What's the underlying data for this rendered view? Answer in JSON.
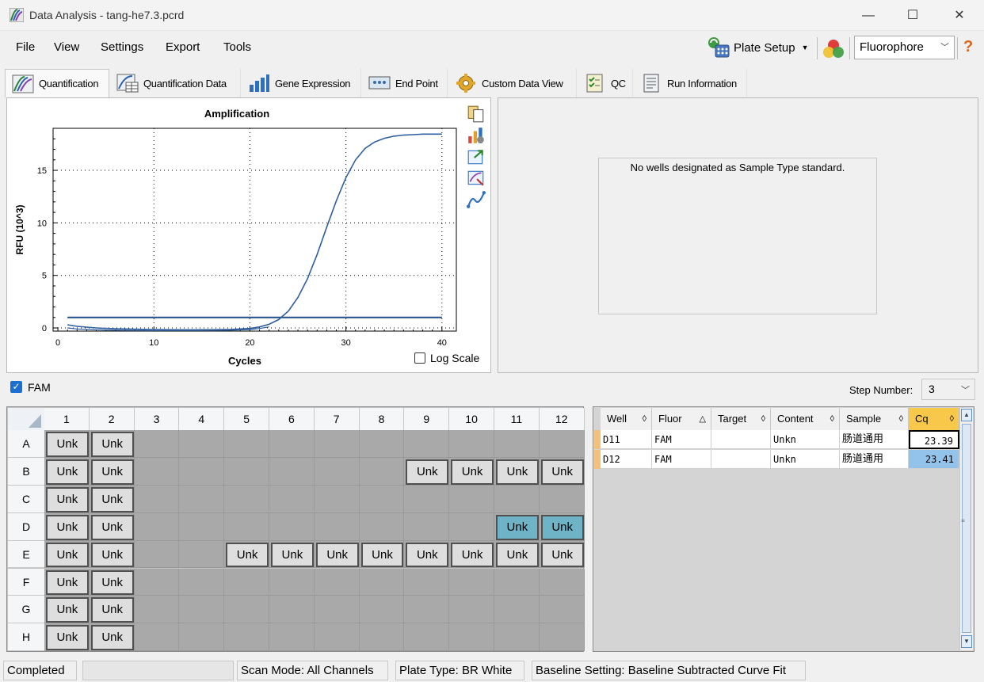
{
  "window": {
    "title": "Data Analysis - tang-he7.3.pcrd",
    "minimize_glyph": "—",
    "maximize_glyph": "☐",
    "close_glyph": "✕"
  },
  "menu": {
    "items": [
      "File",
      "View",
      "Settings",
      "Export",
      "Tools"
    ],
    "plate_setup": "Plate Setup",
    "fluorophore_select": "Fluorophore",
    "help_glyph": "?"
  },
  "tabs": [
    {
      "label": "Quantification",
      "icon": "amplification-icon",
      "active": true
    },
    {
      "label": "Quantification Data",
      "icon": "data-table-icon"
    },
    {
      "label": "Gene Expression",
      "icon": "bar-chart-icon"
    },
    {
      "label": "End Point",
      "icon": "endpoint-icon"
    },
    {
      "label": "Custom Data View",
      "icon": "gear-icon"
    },
    {
      "label": "QC",
      "icon": "checklist-icon"
    },
    {
      "label": "Run Information",
      "icon": "document-icon"
    }
  ],
  "chart_data": {
    "type": "line",
    "title": "Amplification",
    "xlabel": "Cycles",
    "ylabel": "RFU (10^3)",
    "xlim": [
      0,
      40
    ],
    "ylim": [
      -0.3,
      19
    ],
    "xticks": [
      0,
      10,
      20,
      30,
      40
    ],
    "yticks": [
      0,
      5,
      10,
      15
    ],
    "grid": "dotted",
    "colors": {
      "series": "#2f5f9f",
      "threshold": "#1f4e8c"
    },
    "threshold": 1.0,
    "series": [
      {
        "x": [
          1,
          2,
          4,
          6,
          8,
          10,
          12,
          14,
          16,
          18,
          20,
          21,
          22,
          23,
          24,
          25,
          26,
          27,
          28,
          29,
          30,
          31,
          32,
          33,
          34,
          35,
          36,
          37,
          38,
          40
        ],
        "y": [
          0.3,
          0.15,
          0.0,
          -0.08,
          -0.12,
          -0.15,
          -0.17,
          -0.18,
          -0.17,
          -0.14,
          -0.05,
          0.1,
          0.35,
          0.8,
          1.6,
          2.9,
          4.7,
          7.0,
          9.6,
          12.1,
          14.3,
          16.0,
          17.1,
          17.7,
          18.05,
          18.25,
          18.35,
          18.4,
          18.45,
          18.45
        ]
      },
      {
        "x": [
          1,
          2,
          4,
          6,
          8,
          10,
          12,
          14,
          16,
          18,
          20,
          21,
          22
        ],
        "y": [
          0.0,
          -0.1,
          -0.18,
          -0.22,
          -0.24,
          -0.25,
          -0.25,
          -0.25,
          -0.24,
          -0.22,
          -0.15,
          -0.05,
          0.1
        ]
      }
    ],
    "log_scale_label": "Log Scale",
    "log_scale_checked": false
  },
  "standard_curve": {
    "message": "No wells designated as Sample Type standard."
  },
  "fluor_filter": {
    "label": "FAM",
    "checked": true
  },
  "step": {
    "label": "Step Number:",
    "value": "3"
  },
  "plate": {
    "columns": [
      "1",
      "2",
      "3",
      "4",
      "5",
      "6",
      "7",
      "8",
      "9",
      "10",
      "11",
      "12"
    ],
    "rows": [
      "A",
      "B",
      "C",
      "D",
      "E",
      "F",
      "G",
      "H"
    ],
    "well_label": "Unk",
    "wells": {
      "A": [
        1,
        2
      ],
      "B": [
        1,
        2,
        9,
        10,
        11,
        12
      ],
      "C": [
        1,
        2
      ],
      "D": [
        1,
        2,
        11,
        12
      ],
      "E": [
        1,
        2,
        5,
        6,
        7,
        8,
        9,
        10,
        11,
        12
      ],
      "F": [
        1,
        2
      ],
      "G": [
        1,
        2
      ],
      "H": [
        1,
        2
      ]
    },
    "selected": [
      "D11",
      "D12"
    ]
  },
  "results": {
    "columns": [
      {
        "label": "Well",
        "sort": "◊"
      },
      {
        "label": "Fluor",
        "sort": "△"
      },
      {
        "label": "Target",
        "sort": "◊"
      },
      {
        "label": "Content",
        "sort": "◊"
      },
      {
        "label": "Sample",
        "sort": "◊"
      },
      {
        "label": "Cq",
        "sort": "◊"
      }
    ],
    "rows": [
      {
        "well": "D11",
        "fluor": "FAM",
        "target": "",
        "content": "Unkn",
        "sample": "肠道通用",
        "cq": "23.39"
      },
      {
        "well": "D12",
        "fluor": "FAM",
        "target": "",
        "content": "Unkn",
        "sample": "肠道通用",
        "cq": "23.41"
      }
    ]
  },
  "status": {
    "state": "Completed",
    "scan_mode": "Scan Mode: All Channels",
    "plate_type": "Plate Type: BR White",
    "baseline": "Baseline Setting: Baseline Subtracted Curve Fit"
  }
}
